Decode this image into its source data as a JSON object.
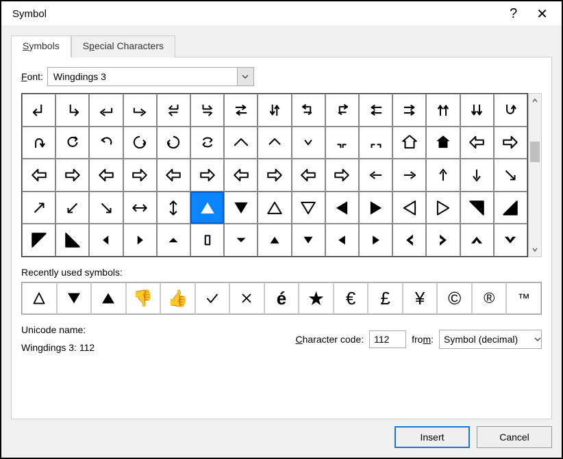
{
  "window": {
    "title": "Symbol"
  },
  "tabs": {
    "symbols": "Symbols",
    "special": "Special Characters"
  },
  "fontRow": {
    "label": "Font:",
    "value": "Wingdings 3"
  },
  "recentLabel": "Recently used symbols:",
  "info": {
    "unicodeNameLabel": "Unicode name:",
    "unicodeName": "Wingdings 3: 112",
    "charCodeLabel": "Character code:",
    "charCode": "112",
    "fromLabel": "from:",
    "fromValue": "Symbol (decimal)"
  },
  "buttons": {
    "insert": "Insert",
    "cancel": "Cancel"
  },
  "selectedCode": 112,
  "grid": [
    "down-left-arrow",
    "down-right-arrow",
    "left-hook-arrow",
    "right-hook-arrow",
    "double-down-left",
    "double-down-right",
    "swap-horizontal",
    "swap-vertical",
    "swap-cycle-left",
    "swap-cycle-right",
    "double-left-arrows",
    "double-right-arrows",
    "double-up-arrows",
    "double-down-arrows",
    "u-turn-down",
    "u-turn-up",
    "rotate-ccw-small",
    "undo-arrow",
    "rotate-full-ccw",
    "rotate-full-cw",
    "refresh",
    "chevron-up-wide",
    "chevron-up",
    "chevron-down-narrow",
    "bracket-low-left",
    "bracket-low-right",
    "home-up-outline",
    "home-up-filled",
    "left-arrow-outline",
    "right-arrow-outline",
    "left-arrow-bold-outline",
    "right-arrow-bold-outline",
    "left-arrow-white",
    "right-arrow-white",
    "left-arrow-hollow",
    "right-arrow-hollow",
    "left-arrow-shadow",
    "right-arrow-shadow",
    "left-arrow-3d",
    "right-arrow-3d",
    "left-arrow-thin",
    "right-arrow-thin",
    "up-arrow-thin",
    "down-arrow-thin",
    "down-right-arrow-thin",
    "ne-arrow",
    "sw-arrow",
    "se-arrow",
    "left-right-arrow",
    "up-down-arrow",
    "triangle-up-filled",
    "triangle-down-filled",
    "triangle-up-outline",
    "triangle-down-outline",
    "triangle-left-filled",
    "triangle-right-filled",
    "triangle-left-outline",
    "triangle-right-outline",
    "triangle-corner-tr",
    "triangle-corner-br",
    "triangle-corner-tl",
    "triangle-corner-bl",
    "pointer-left-small",
    "pointer-right-small",
    "caret-up-small",
    "rectangle-outline",
    "caret-down-small",
    "triangle-up-small",
    "triangle-down-small",
    "triangle-left-small",
    "triangle-right-small",
    "chevron-left-bold",
    "chevron-right-bold",
    "chevron-up-bold",
    "chevron-down-bold"
  ],
  "recent": [
    "delta",
    "triangle-down-filled",
    "triangle-up-filled",
    "thumbs-down",
    "thumbs-up",
    "checkmark",
    "x-mark",
    "e-acute",
    "star",
    "euro",
    "pound",
    "yen",
    "copyright",
    "registered",
    "trademark"
  ]
}
